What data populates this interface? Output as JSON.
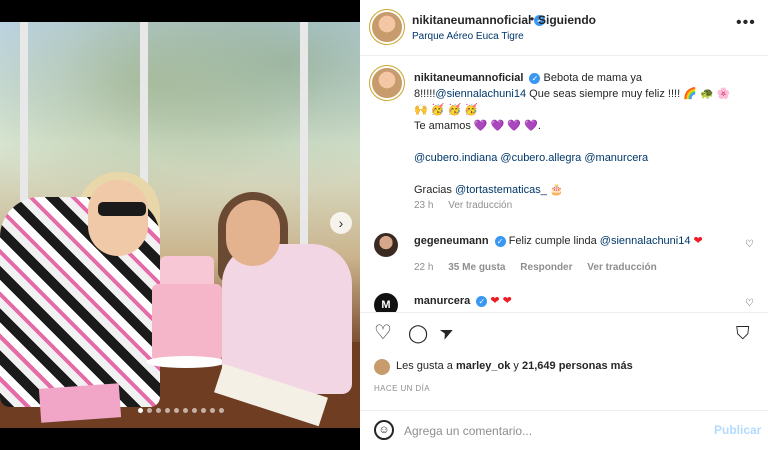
{
  "header": {
    "username": "nikitaneumannoficial",
    "verified_mark": "✓",
    "separator": "•",
    "follow_label": "Siguiendo",
    "location": "Parque Aéreo Euca Tigre",
    "more": "•••"
  },
  "caption": {
    "username": "nikitaneumannoficial",
    "line1": "Bebota de mama ya 8!!!!!",
    "mention1": "@siennalachuni14",
    "line1b": " Que seas siempre muy feliz !!!! 🌈 🐢 🌸",
    "line2": "🙌 🥳 🥳 🥳",
    "line3": "Te amamos 💜 💜 💜 💜.",
    "mentions2": [
      "@cubero.indiana",
      "@cubero.allegra",
      "@manurcera"
    ],
    "thanks_prefix": "Gracias ",
    "thanks_mention": "@tortastematicas_",
    "thanks_suffix": " 🎂",
    "time": "23 h",
    "translate": "Ver traducción"
  },
  "comments": [
    {
      "username": "gegeneumann",
      "verified_mark": "✓",
      "text_prefix": " Feliz cumple linda ",
      "mention": "@siennalachuni14",
      "text_suffix": " ❤",
      "time": "22 h",
      "likes": "35 Me gusta",
      "reply": "Responder",
      "translate": "Ver traducción",
      "heart_icon": "♡"
    },
    {
      "username": "manurcera",
      "verified_mark": "✓",
      "text": " ❤ ❤",
      "avatar_letter": "M",
      "heart_icon": "♡"
    }
  ],
  "actions": {
    "like_icon": "♡",
    "comment_icon": "◯",
    "share_icon": "➤",
    "save_icon": "⛉"
  },
  "likes": {
    "prefix": "Les gusta a ",
    "user": "marley_ok",
    "middle": " y ",
    "count": "21,649 personas más"
  },
  "ago": "HACE UN DÍA",
  "composer": {
    "emoji_icon": "☺",
    "placeholder": "Agrega un comentario...",
    "publish": "Publicar"
  },
  "carousel": {
    "next_icon": "›",
    "slide_count": 10,
    "active_slide": 1
  }
}
